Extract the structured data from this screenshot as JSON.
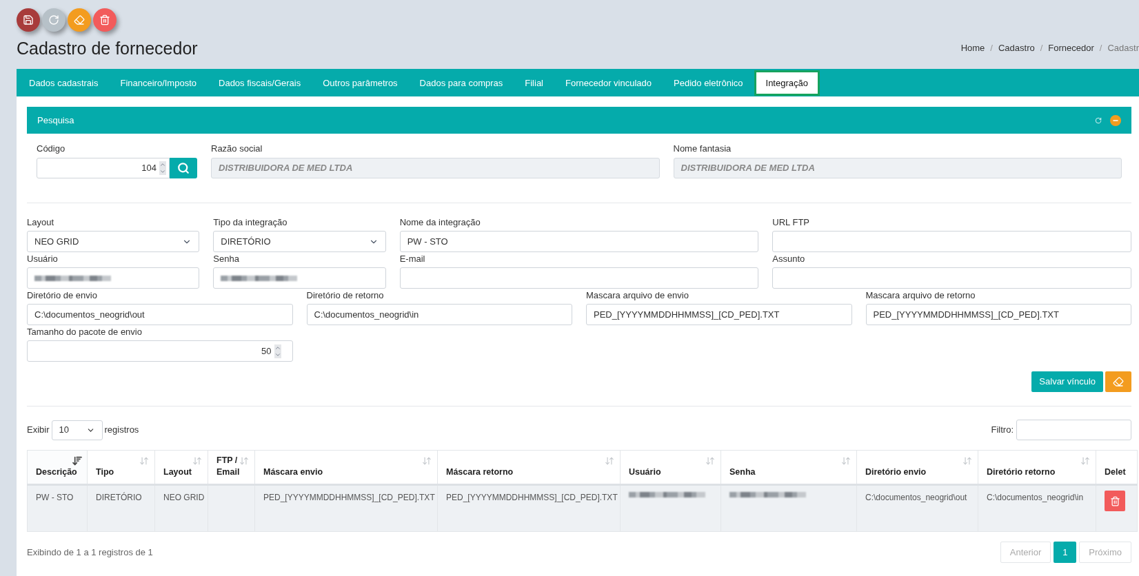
{
  "toolbar": [
    {
      "kind": "save"
    },
    {
      "kind": "refresh"
    },
    {
      "kind": "eraser"
    },
    {
      "kind": "delete"
    }
  ],
  "page_title": "Cadastro de fornecedor",
  "breadcrumb": [
    "Home",
    "Cadastro",
    "Fornecedor",
    "Cadastr"
  ],
  "breadcrumb_separator": "/",
  "tabs": [
    {
      "label": "Dados cadastrais",
      "selected": false
    },
    {
      "label": "Financeiro/Imposto",
      "selected": false
    },
    {
      "label": "Dados fiscais/Gerais",
      "selected": false
    },
    {
      "label": "Outros parâmetros",
      "selected": false
    },
    {
      "label": "Dados para compras",
      "selected": false
    },
    {
      "label": "Filial",
      "selected": false
    },
    {
      "label": "Fornecedor vinculado",
      "selected": false
    },
    {
      "label": "Pedido eletrônico",
      "selected": false
    },
    {
      "label": "Integração",
      "selected": true
    }
  ],
  "search_panel": {
    "title": "Pesquisa",
    "fields": [
      {
        "label": "Código",
        "kind": "number",
        "value": "104",
        "disabled": false
      },
      {
        "label": "Razão social",
        "kind": "text",
        "value": "DISTRIBUIDORA DE MED LTDA",
        "disabled": true
      },
      {
        "label": "Nome fantasia",
        "kind": "text",
        "value": "DISTRIBUIDORA DE MED LTDA",
        "disabled": true
      }
    ]
  },
  "form": {
    "rows": [
      [
        {
          "label": "Layout",
          "kind": "select",
          "value": "NEO GRID"
        },
        {
          "label": "Tipo da integração",
          "kind": "select",
          "value": "DIRETÓRIO"
        },
        {
          "label": "Nome da integração",
          "kind": "text",
          "value": "PW - STO"
        },
        {
          "label": "URL FTP",
          "kind": "text"
        }
      ],
      [
        {
          "label": "Usuário",
          "kind": "blurred"
        },
        {
          "label": "Senha",
          "kind": "blurred"
        },
        {
          "label": "E-mail",
          "kind": "text"
        },
        {
          "label": "Assunto",
          "kind": "text"
        }
      ],
      [
        {
          "label": "Diretório de envio",
          "kind": "text",
          "value": "C:\\documentos_neogrid\\out"
        },
        {
          "label": "Diretório de retorno",
          "kind": "text",
          "value": "C:\\documentos_neogrid\\in"
        },
        {
          "label": "Mascara arquivo de envio",
          "kind": "text",
          "value": "PED_[YYYYMMDDHHMMSS]_[CD_PED].TXT"
        },
        {
          "label": "Mascara arquivo de retorno",
          "kind": "text",
          "value": "PED_[YYYYMMDDHHMMSS]_[CD_PED].TXT"
        }
      ],
      [
        {
          "label": "Tamanho do pacote de envio",
          "kind": "number",
          "value": "50"
        }
      ]
    ],
    "save_label": "Salvar vínculo"
  },
  "table": {
    "show_before": "Exibir",
    "page_size": "10",
    "show_after": "registros",
    "filter_label": "Filtro:",
    "columns": [
      {
        "label": "Descrição",
        "sortable": true,
        "sorted": true
      },
      {
        "label": "Tipo",
        "sortable": true,
        "sorted": false
      },
      {
        "label": "Layout",
        "sortable": true,
        "sorted": false
      },
      {
        "label": "FTP / Email",
        "sortable": true,
        "sorted": false
      },
      {
        "label": "Máscara envio",
        "sortable": true,
        "sorted": false
      },
      {
        "label": "Máscara retorno",
        "sortable": true,
        "sorted": false
      },
      {
        "label": "Usuário",
        "sortable": true,
        "sorted": false
      },
      {
        "label": "Senha",
        "sortable": true,
        "sorted": false
      },
      {
        "label": "Diretório envio",
        "sortable": true,
        "sorted": false
      },
      {
        "label": "Diretório retorno",
        "sortable": true,
        "sorted": false
      },
      {
        "label": "Delet",
        "sortable": false
      }
    ],
    "rows": [
      {
        "cells": [
          {
            "kind": "text",
            "text": "PW - STO"
          },
          {
            "kind": "text",
            "text": "DIRETÓRIO"
          },
          {
            "kind": "text",
            "text": "NEO GRID"
          },
          {
            "kind": "text"
          },
          {
            "kind": "text",
            "text": "PED_[YYYYMMDDHHMMSS]_[CD_PED].TXT"
          },
          {
            "kind": "text",
            "text": "PED_[YYYYMMDDHHMMSS]_[CD_PED].TXT"
          },
          {
            "kind": "blurred"
          },
          {
            "kind": "blurred"
          },
          {
            "kind": "text",
            "text": "C:\\documentos_neogrid\\out"
          },
          {
            "kind": "text",
            "text": "C:\\documentos_neogrid\\in"
          },
          {
            "kind": "delete"
          }
        ]
      }
    ],
    "info": "Exibindo de 1 a 1 registros de 1",
    "pagination": {
      "previous": "Anterior",
      "pages": [
        {
          "label": "1",
          "selected": true
        }
      ],
      "next": "Próximo"
    }
  }
}
